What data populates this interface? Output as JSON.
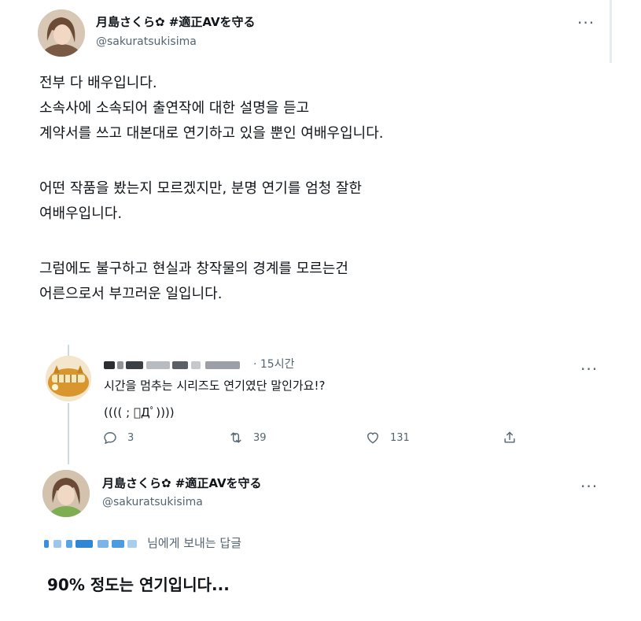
{
  "main_tweet": {
    "display_name": "月島さくら✿ #適正AVを守る",
    "handle": "@sakuratsukisima",
    "lines": [
      "전부 다 배우입니다.",
      "소속사에 소속되어 출연작에 대한 설명을 듣고",
      "계약서를 쓰고 대본대로 연기하고 있을 뿐인 여배우입니다.",
      "",
      "어떤 작품을 봤는지 모르겠지만, 분명 연기를 엄청 잘한",
      "여배우입니다.",
      "",
      "그럼에도 불구하고 현실과 창작물의 경계를 모르는건",
      "어른으로서 부끄러운 일입니다."
    ]
  },
  "reply_tweet": {
    "time_ago": "· 15시간",
    "text_line1": "시간을 멈추는 시리즈도 연기였단 말인가요!?",
    "text_line2": "(((( ; ﾟДﾟ))))",
    "replies": "3",
    "retweets": "39",
    "likes": "131"
  },
  "answer_tweet": {
    "display_name": "月島さくら✿ #適正AVを守る",
    "handle": "@sakuratsukisima",
    "replying_to_suffix": "님에게 보내는 답글",
    "text": "90% 정도는 연기입니다..."
  },
  "colors": {
    "text": "#0f1419",
    "secondary": "#536471",
    "thread_line": "#cfd9de",
    "accent_blue": "#1d9bf0"
  },
  "icons": [
    "more-icon",
    "reply-icon",
    "retweet-icon",
    "like-icon",
    "share-icon"
  ]
}
